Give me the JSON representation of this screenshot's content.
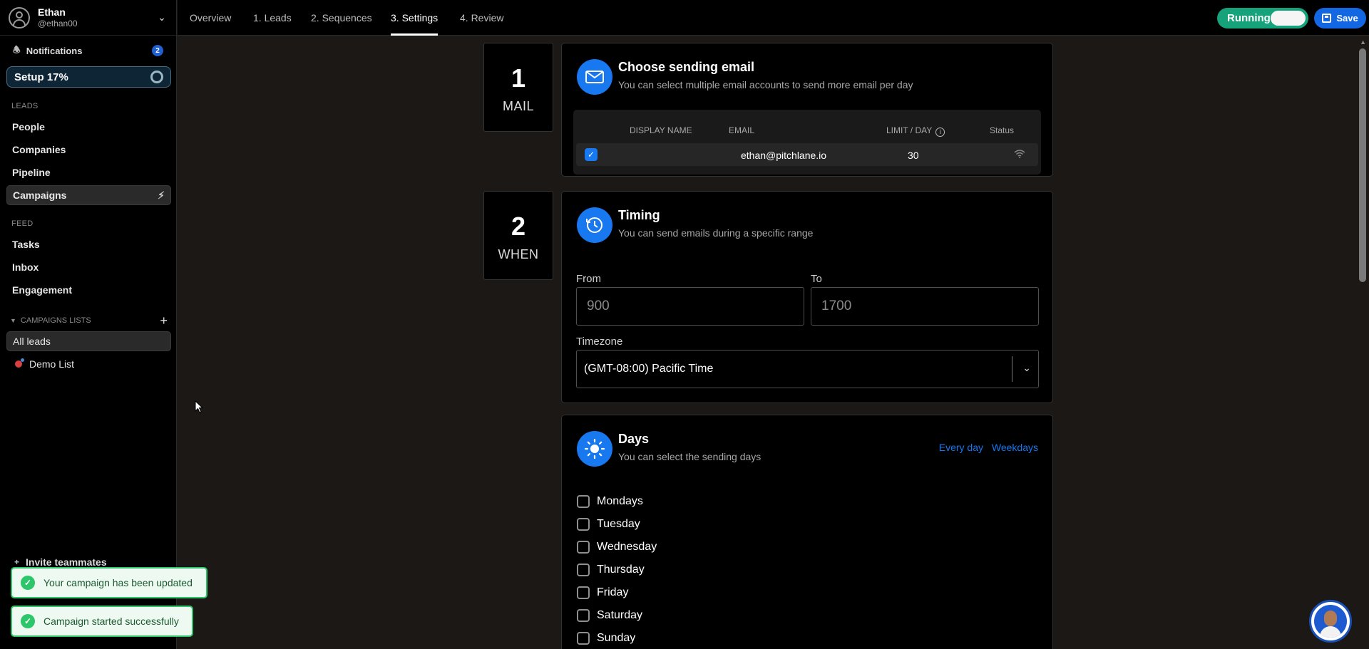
{
  "user": {
    "name": "Ethan",
    "handle": "@ethan00"
  },
  "sidebar": {
    "notifications_label": "Notifications",
    "notifications_count": "2",
    "setup_label": "Setup 17%",
    "leads_section": "LEADS",
    "leads_items": [
      "People",
      "Companies",
      "Pipeline",
      "Campaigns"
    ],
    "feed_section": "FEED",
    "feed_items": [
      "Tasks",
      "Inbox",
      "Engagement"
    ],
    "campaign_lists_label": "CAMPAIGNS LISTS",
    "lists": [
      "All leads",
      "Demo List"
    ],
    "invite_label": "Invite teammates"
  },
  "tabs": [
    "Overview",
    "1. Leads",
    "2. Sequences",
    "3. Settings",
    "4. Review"
  ],
  "active_tab": "3. Settings",
  "header": {
    "running_label": "Running",
    "save_label": "Save"
  },
  "steps": [
    {
      "number": "1",
      "word": "MAIL"
    },
    {
      "number": "2",
      "word": "WHEN"
    }
  ],
  "mail_card": {
    "title": "Choose sending email",
    "subtitle": "You can select multiple email accounts to send more email per day",
    "columns": {
      "display_name": "DISPLAY NAME",
      "email": "EMAIL",
      "limit": "LIMIT / DAY",
      "status": "Status"
    },
    "row": {
      "email": "ethan@pitchlane.io",
      "limit": "30",
      "checked": true
    }
  },
  "timing_card": {
    "title": "Timing",
    "subtitle": "You can send emails during a specific range",
    "from_label": "From",
    "from_placeholder": "900",
    "to_label": "To",
    "to_placeholder": "1700",
    "timezone_label": "Timezone",
    "timezone_value": "(GMT-08:00) Pacific Time"
  },
  "days_card": {
    "title": "Days",
    "subtitle": "You can select the sending days",
    "every_day_link": "Every day",
    "weekdays_link": "Weekdays",
    "days": [
      "Mondays",
      "Tuesday",
      "Wednesday",
      "Thursday",
      "Friday",
      "Saturday",
      "Sunday"
    ]
  },
  "toasts": [
    "Your campaign has been updated",
    "Campaign started successfully"
  ],
  "colors": {
    "accent": "#1778f0",
    "running": "#16a37b",
    "save": "#1467e2",
    "toast_border": "#2dc66a"
  }
}
